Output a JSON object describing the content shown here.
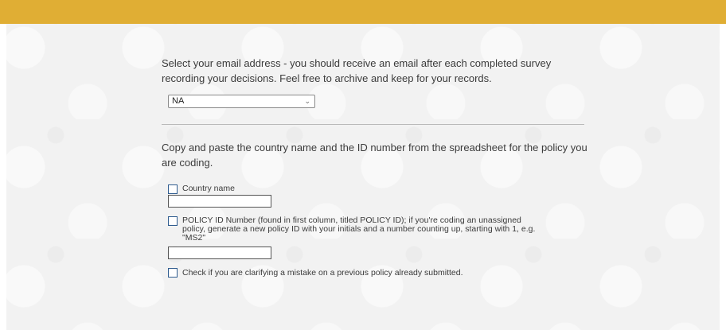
{
  "q1": {
    "text": "Select your email address - you should receive an email after each completed survey recording your decisions. Feel free to archive and keep for your records.",
    "dropdown": {
      "selected": "NA"
    },
    "icon": "chevron-down-icon"
  },
  "q2": {
    "text": "Copy and paste the country name and the ID number from the spreadsheet for the policy you are coding.",
    "options": [
      {
        "label": "Country name",
        "input_value": ""
      },
      {
        "label": "POLICY ID Number (found in first column, titled POLICY ID); if you're coding an unassigned policy, generate a new policy ID with your initials and a number counting up, starting with 1, e.g. \"MS2\"",
        "input_value": ""
      },
      {
        "label": "Check if you are clarifying a mistake on a previous policy already submitted."
      }
    ]
  },
  "colors": {
    "header": "#e0ae34",
    "checkbox_border": "#2f5c8f"
  }
}
